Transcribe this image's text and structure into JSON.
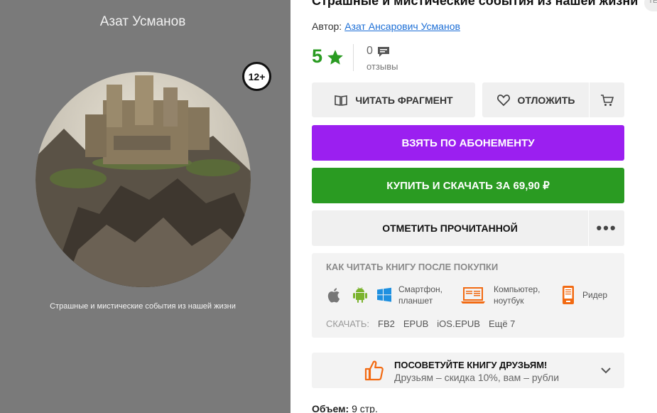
{
  "cover": {
    "author": "Азат Усманов",
    "age_rating": "12+",
    "title": "Страшные и мистические события из нашей жизни"
  },
  "book": {
    "title": "Страшные и мистические события из нашей жизни",
    "genre_chip": "ТЕ",
    "author_label": "Автор:",
    "author_name": "Азат Ансарович Усманов"
  },
  "rating": {
    "value": "5",
    "reviews_count": "0",
    "reviews_label": "отзывы"
  },
  "actions": {
    "read_fragment": "Читать фрагмент",
    "defer": "Отложить",
    "subscribe": "Взять по абонементу",
    "buy": "Купить и скачать за 69,90 ₽",
    "mark_read": "Отметить прочитанной",
    "more": "•••"
  },
  "howto": {
    "title": "Как читать книгу после покупки",
    "smartphone": "Смартфон,",
    "smartphone2": "планшет",
    "computer": "Компьютер,",
    "computer2": "ноутбук",
    "reader": "Ридер",
    "download_label": "Скачать:",
    "formats": [
      "FB2",
      "EPUB",
      "iOS.EPUB",
      "Ещё 7"
    ]
  },
  "recommend": {
    "title": "Посоветуйте книгу друзьям!",
    "subtitle": "Друзьям – скидка 10%, вам – рубли"
  },
  "details": {
    "volume_label": "Объем:",
    "volume_value": "9 стр."
  },
  "colors": {
    "accent_green": "#2a9b22",
    "accent_purple": "#9b1ff0",
    "link_blue": "#1d6fd6",
    "orange": "#f26a12"
  }
}
